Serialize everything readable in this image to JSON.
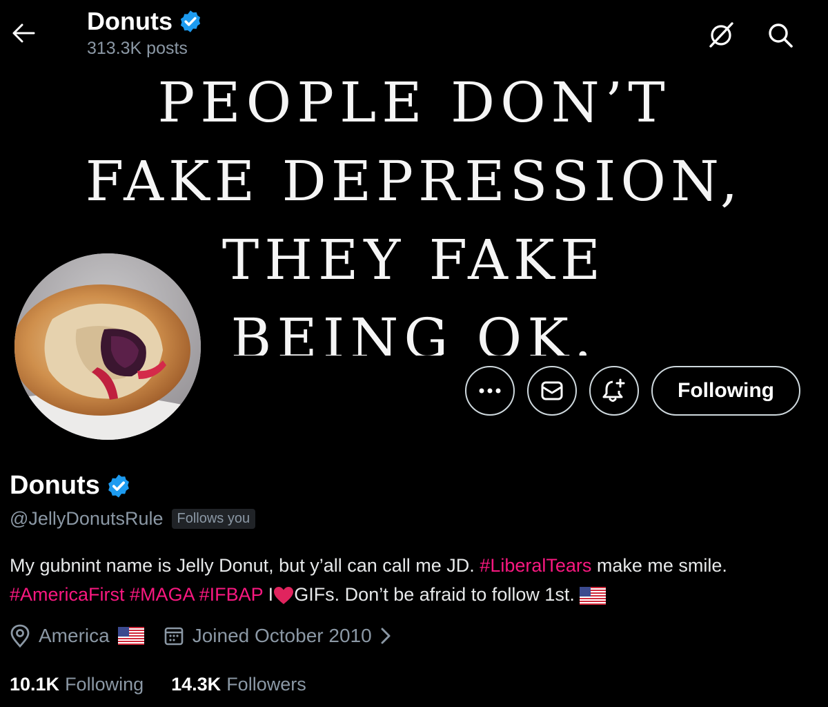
{
  "header": {
    "title": "Donuts",
    "posts_count": "313.3K posts"
  },
  "banner": {
    "quote_lines": [
      "PEOPLE DON’T",
      "FAKE DEPRESSION,",
      "THEY FAKE",
      "BEING OK."
    ]
  },
  "actions": {
    "following_label": "Following"
  },
  "profile": {
    "display_name": "Donuts",
    "handle": "@JellyDonutsRule",
    "follows_you": "Follows you",
    "bio": {
      "p1": "My gubnint name is Jelly Donut, but y’all can call me JD. ",
      "tag1": "#LiberalTears",
      "p2": " make me smile. ",
      "tag2": "#AmericaFirst",
      "tag3": "#MAGA",
      "tag4": "#IFBAP",
      "p3": " I",
      "p4": "GIFs. Don’t be afraid to follow 1st."
    },
    "location": "America",
    "joined": "Joined October 2010",
    "following_count": "10.1K",
    "following_label": "Following",
    "followers_count": "14.3K",
    "followers_label": "Followers"
  },
  "colors": {
    "background": "#000000",
    "text": "#e7e9ea",
    "muted": "#8b98a5",
    "hashtag": "#f91880",
    "verified": "#1d9bf0",
    "heart": "#e0245e"
  }
}
